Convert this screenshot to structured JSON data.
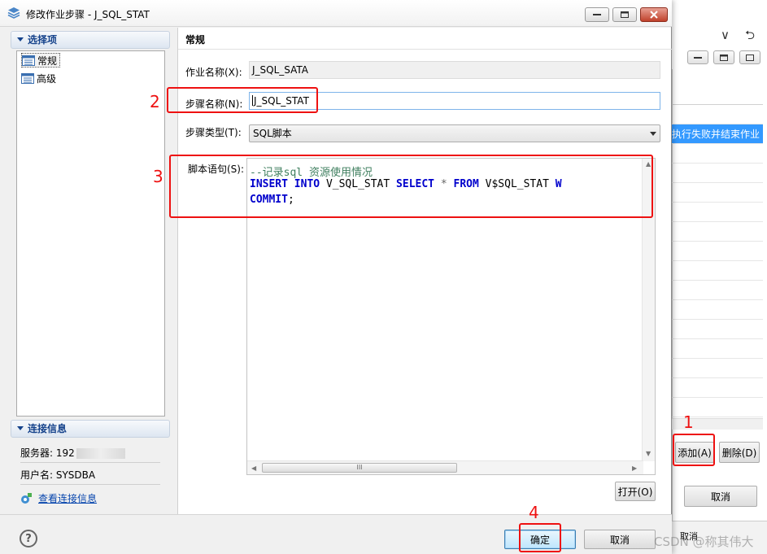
{
  "dialog": {
    "title": "修改作业步骤 - J_SQL_STAT",
    "nav_section_title": "选择项",
    "nav_items": [
      "常规",
      "高级"
    ],
    "conn_section_title": "连接信息",
    "server_label": "服务器: 192",
    "user_label": "用户名: SYSDBA",
    "conn_link": "查看连接信息",
    "pane_title": "常规",
    "job_name_label": "作业名称(X):",
    "job_name_value": "J_SQL_SATA",
    "step_name_label": "步骤名称(N):",
    "step_name_value": "J_SQL_STAT",
    "step_type_label": "步骤类型(T):",
    "step_type_value": "SQL脚本",
    "script_label": "脚本语句(S):",
    "script": {
      "line1_comment": "--记录sql 资源使用情况",
      "line2": {
        "kw1": "INSERT",
        "kw2": "INTO",
        "ident1": "V_SQL_STAT",
        "kw3": "SELECT",
        "op": "*",
        "kw4": "FROM",
        "ident2": "V$SQL_STAT",
        "tail": "W"
      },
      "line3": {
        "kw": "COMMIT",
        "tail": ";"
      }
    },
    "scroll_thumb": "III",
    "open_button": "打开(O)",
    "ok_button": "确定",
    "cancel_button": "取消",
    "help_icon": "?"
  },
  "background": {
    "selected_row_text": "执行失败并结束作业",
    "add_button": "添加(A)",
    "delete_button": "删除(D)",
    "cancel_button": "取消",
    "strip_cancel": "取消",
    "glyph_chevron": "∨",
    "glyph_undo": "⮌"
  },
  "annotations": [
    "1",
    "2",
    "3",
    "4"
  ],
  "watermark": "CSDN @称其伟大",
  "colors": {
    "annotation_red": "#ee1111",
    "section_header_text": "#15428b",
    "sql_keyword": "#0000cc",
    "sql_comment": "#3f7f5f",
    "selection_blue": "#3399ff"
  }
}
